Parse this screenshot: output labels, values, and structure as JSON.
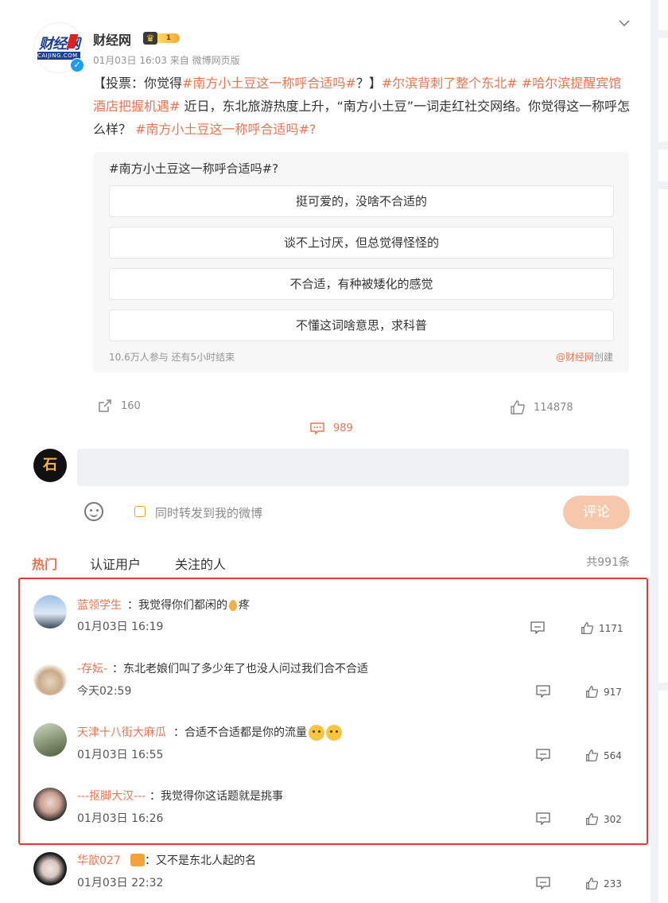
{
  "post": {
    "author": "财经网",
    "level": "1",
    "meta": "01月03日 16:03  来自 微博网页版",
    "text": {
      "p1": "【投票：你觉得",
      "t1": "#南方小土豆这一称呼合适吗#",
      "p2": "？】",
      "t2": "#尔滨背刺了整个东北#",
      "p3": " ",
      "t3": "#哈尔滨提醒宾馆酒店把握机遇#",
      "p4": " 近日，东北旅游热度上升，“南方小土豆”一词走红社交网络。你觉得这一称呼怎么样？ ",
      "t4": "#南方小土豆这一称呼合适吗#?"
    },
    "logo_text": "财经网",
    "logo_sub": "CAIJING.COM"
  },
  "poll": {
    "question": "#南方小土豆这一称呼合适吗#?",
    "options": [
      "挺可爱的，没啥不合适的",
      "谈不上讨厌，但总觉得怪怪的",
      "不合适，有种被矮化的感觉",
      "不懂这词啥意思，求科普"
    ],
    "footer": "10.6万人参与 还有5小时结束",
    "creator_at": "@财经网",
    "creator_suffix": "创建"
  },
  "actions": {
    "share_count": "160",
    "comment_count": "989",
    "like_count": "114878"
  },
  "compose": {
    "my_avatar_text": "石",
    "forward_label": "同时转发到我的微博",
    "submit_label": "评论"
  },
  "tabs": {
    "hot": "热门",
    "verified": "认证用户",
    "following": "关注的人",
    "total": "共991条"
  },
  "comments": [
    {
      "name": "蓝领学生",
      "sep": "：",
      "text_a": "我觉得你们都闲的",
      "text_b": "疼",
      "time": "01月03日 16:19",
      "likes": "1171"
    },
    {
      "name": "-存妘-",
      "sep": "：",
      "text_a": "东北老娘们叫了多少年了也没人问过我们合不合适",
      "time": "今天02:59",
      "likes": "917"
    },
    {
      "name": "天津十八街大麻瓜",
      "sep": "：",
      "text_a": "合适不合适都是你的流量",
      "time": "01月03日 16:55",
      "likes": "564"
    },
    {
      "name": "---抠脚大汉---",
      "sep": "：",
      "text_a": "我觉得你这话题就是挑事",
      "time": "01月03日 16:26",
      "likes": "302"
    },
    {
      "name": "华歆027",
      "sep": "：",
      "text_a": "又不是东北人起的名",
      "time": "01月03日 22:32",
      "likes": "233"
    }
  ]
}
